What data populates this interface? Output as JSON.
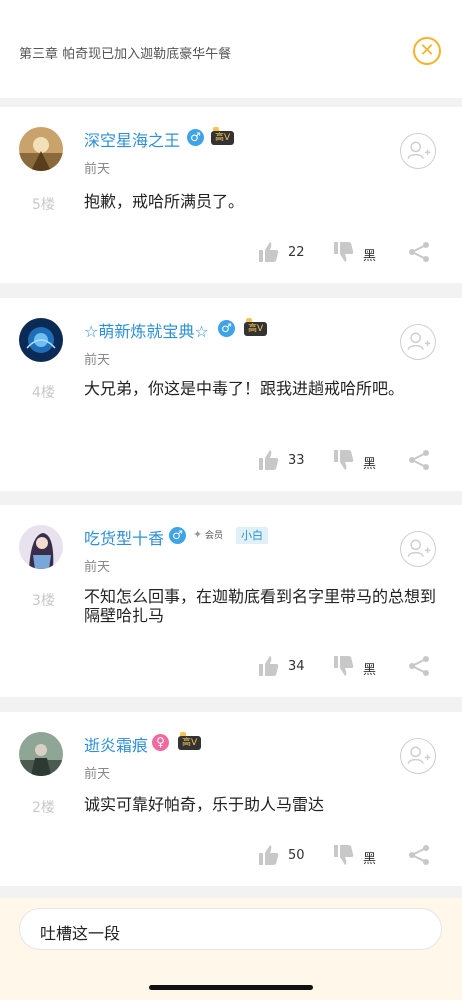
{
  "header": {
    "title": "第三章  帕奇现已加入迦勒底豪华午餐",
    "close_icon": "close-icon"
  },
  "comments": [
    {
      "username": "深空星海之王",
      "gender": "♂",
      "badge": "高V",
      "time": "前天",
      "floor": "5楼",
      "content": "抱歉，戒哈所满员了。",
      "likes": "22",
      "dislike_label": "黑"
    },
    {
      "username": "☆萌新炼就宝典☆",
      "gender": "♂",
      "badge": "高V",
      "time": "前天",
      "floor": "4楼",
      "content": "大兄弟，你这是中毒了！跟我进趟戒哈所吧。",
      "likes": "33",
      "dislike_label": "黑"
    },
    {
      "username": "吃货型十香",
      "gender": "♂",
      "badge_member": "会员",
      "badge_level": "小白",
      "time": "前天",
      "floor": "3楼",
      "content": "不知怎么回事，在迦勒底看到名字里带马的总想到隔壁哈扎马",
      "likes": "34",
      "dislike_label": "黑"
    },
    {
      "username": "逝炎霜痕",
      "gender": "♀",
      "badge": "高V",
      "time": "前天",
      "floor": "2楼",
      "content": "诚实可靠好帕奇，乐于助人马雷达",
      "likes": "50",
      "dislike_label": "黑"
    }
  ],
  "bottom": {
    "input_text": "吐槽这一段"
  },
  "colors": {
    "accent_blue": "#2f8fd6",
    "close_yellow": "#f0b52a",
    "bottom_bg": "#fff8ea"
  }
}
